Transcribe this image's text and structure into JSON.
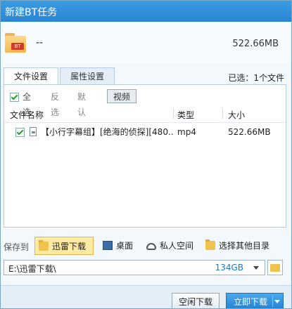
{
  "window": {
    "title": "新建BT任务"
  },
  "header": {
    "folder_badge": "BT",
    "task_name": "--",
    "total_size": "522.66MB"
  },
  "tabs": [
    {
      "label": "文件设置",
      "active": true
    },
    {
      "label": "属性设置",
      "active": false
    }
  ],
  "selection_info": "已选：1个文件",
  "filters": {
    "select_all": "全选",
    "invert": "反选",
    "default": "默认",
    "video": "视频"
  },
  "columns": {
    "name": "文件名称",
    "type": "类型",
    "size": "大小"
  },
  "files": [
    {
      "checked": true,
      "name": "【小行字幕组】[绝海的侦探][480...",
      "type": "mp4",
      "size": "522.66MB"
    }
  ],
  "save_to": {
    "label": "保存到",
    "options": [
      {
        "label": "迅雷下载",
        "active": true,
        "icon": "folder-icon"
      },
      {
        "label": "桌面",
        "active": false,
        "icon": "desktop-icon"
      },
      {
        "label": "私人空间",
        "active": false,
        "icon": "cloud-icon"
      },
      {
        "label": "选择其他目录",
        "active": false,
        "icon": "folder-icon"
      }
    ]
  },
  "path": {
    "value": "E:\\迅雷下载\\",
    "free_space": "134GB"
  },
  "buttons": {
    "idle_download": "空闲下载",
    "download_now": "立即下载"
  },
  "colors": {
    "title_bar": "#2a86d4",
    "accent": "#1f7acb",
    "active_option": "#fdeaa4"
  }
}
